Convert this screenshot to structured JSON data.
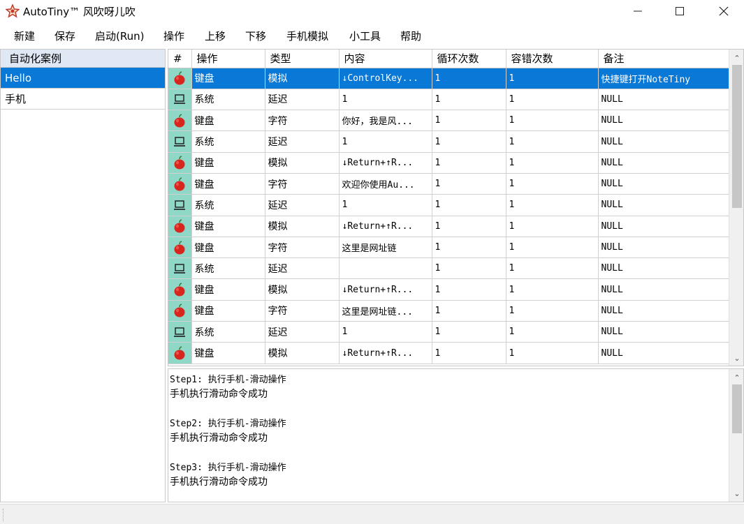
{
  "window": {
    "title": "AutoTiny™ 风吹呀儿吹",
    "minimize_glyph": "—",
    "maximize_glyph": "☐",
    "close_glyph": "✕"
  },
  "menu": [
    "新建",
    "保存",
    "启动(Run)",
    "操作",
    "上移",
    "下移",
    "手机模拟",
    "小工具",
    "帮助"
  ],
  "sidebar": {
    "header": "自动化案例",
    "items": [
      {
        "label": "Hello",
        "selected": true
      },
      {
        "label": "手机",
        "selected": false
      }
    ]
  },
  "table": {
    "columns": [
      "#",
      "操作",
      "类型",
      "内容",
      "循环次数",
      "容错次数",
      "备注"
    ],
    "rows": [
      {
        "icon": "apple-icon",
        "op": "键盘",
        "type": "模拟",
        "content": "↓ControlKey...",
        "loop": "1",
        "retry": "1",
        "note": "快捷键打开NoteTiny",
        "selected": true
      },
      {
        "icon": "computer-icon",
        "op": "系统",
        "type": "延迟",
        "content": "1",
        "loop": "1",
        "retry": "1",
        "note": "NULL"
      },
      {
        "icon": "apple-icon",
        "op": "键盘",
        "type": "字符",
        "content": "你好，我是风...",
        "loop": "1",
        "retry": "1",
        "note": "NULL"
      },
      {
        "icon": "computer-icon",
        "op": "系统",
        "type": "延迟",
        "content": "1",
        "loop": "1",
        "retry": "1",
        "note": "NULL"
      },
      {
        "icon": "apple-icon",
        "op": "键盘",
        "type": "模拟",
        "content": "↓Return+↑R...",
        "loop": "1",
        "retry": "1",
        "note": "NULL"
      },
      {
        "icon": "apple-icon",
        "op": "键盘",
        "type": "字符",
        "content": "欢迎你使用Au...",
        "loop": "1",
        "retry": "1",
        "note": "NULL"
      },
      {
        "icon": "computer-icon",
        "op": "系统",
        "type": "延迟",
        "content": "1",
        "loop": "1",
        "retry": "1",
        "note": "NULL"
      },
      {
        "icon": "apple-icon",
        "op": "键盘",
        "type": "模拟",
        "content": "↓Return+↑R...",
        "loop": "1",
        "retry": "1",
        "note": "NULL"
      },
      {
        "icon": "apple-icon",
        "op": "键盘",
        "type": "字符",
        "content": "这里是网址链",
        "loop": "1",
        "retry": "1",
        "note": "NULL"
      },
      {
        "icon": "computer-icon",
        "op": "系统",
        "type": "延迟",
        "content": "",
        "loop": "1",
        "retry": "1",
        "note": "NULL"
      },
      {
        "icon": "apple-icon",
        "op": "键盘",
        "type": "模拟",
        "content": "↓Return+↑R...",
        "loop": "1",
        "retry": "1",
        "note": "NULL"
      },
      {
        "icon": "apple-icon",
        "op": "键盘",
        "type": "字符",
        "content": "这里是网址链...",
        "loop": "1",
        "retry": "1",
        "note": "NULL"
      },
      {
        "icon": "computer-icon",
        "op": "系统",
        "type": "延迟",
        "content": "1",
        "loop": "1",
        "retry": "1",
        "note": "NULL"
      },
      {
        "icon": "apple-icon",
        "op": "键盘",
        "type": "模拟",
        "content": "↓Return+↑R...",
        "loop": "1",
        "retry": "1",
        "note": "NULL"
      }
    ],
    "scroll_up_glyph": "⌃",
    "scroll_down_glyph": "⌄"
  },
  "log": {
    "lines": [
      "Step1: 执行手机-滑动操作",
      "手机执行滑动命令成功",
      "",
      "Step2: 执行手机-滑动操作",
      "手机执行滑动命令成功",
      "",
      "Step3: 执行手机-滑动操作",
      "手机执行滑动命令成功"
    ]
  },
  "colors": {
    "selection": "#0a78d7",
    "icon_column": "#8fd8c8",
    "sidebar_header": "#dfe8f4",
    "app_icon": "#d9534f"
  }
}
